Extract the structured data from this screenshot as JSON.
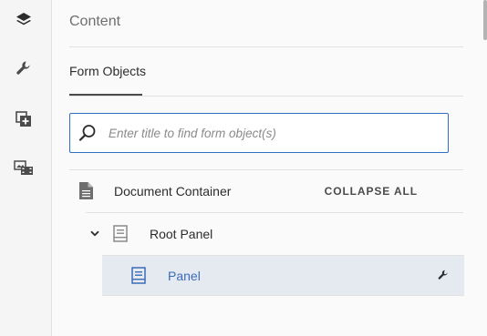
{
  "rail": {
    "items": [
      {
        "icon": "layers-icon"
      },
      {
        "icon": "wrench-icon"
      },
      {
        "icon": "add-panel-icon"
      },
      {
        "icon": "media-icon"
      }
    ]
  },
  "panel": {
    "title": "Content",
    "tab": "Form Objects",
    "search": {
      "placeholder": "Enter title to find form object(s)",
      "value": ""
    },
    "tree": {
      "root_label": "Document Container",
      "collapse_all": "COLLAPSE ALL",
      "items": [
        {
          "label": "Root Panel",
          "expanded": true
        },
        {
          "label": "Panel",
          "selected": true
        }
      ]
    }
  },
  "colors": {
    "accent": "#2d6fc1",
    "selected_row": "#e5e9f0",
    "selected_text": "#3b6cb8",
    "icon_gray": "#6e6e6e"
  }
}
